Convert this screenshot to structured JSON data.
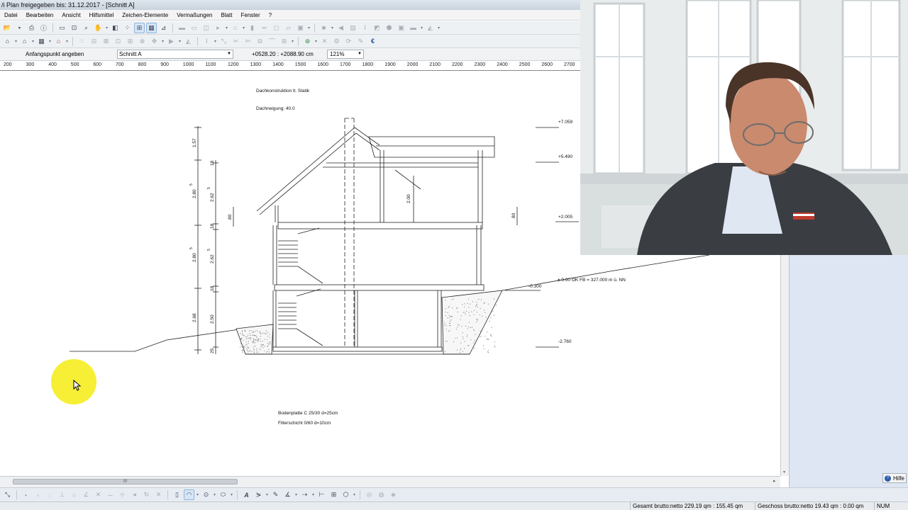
{
  "window": {
    "title": "/i Plan freigegeben bis: 31.12.2017 - [Schnitt A]"
  },
  "menu": [
    "Datei",
    "Bearbeiten",
    "Ansicht",
    "Hilfsmittel",
    "Zeichen-Elemente",
    "Vermaßungen",
    "Blatt",
    "Fenster",
    "?"
  ],
  "infobar": {
    "prompt": "Anfangspunkt angeben",
    "view_select": "Schnitt A",
    "coordinates": "+0528.20 : +2088.90 cm",
    "zoom": "121%"
  },
  "toolbar": {
    "euro_label": "€"
  },
  "ruler": {
    "ticks": [
      "200",
      "300",
      "400",
      "500",
      "600",
      "700",
      "800",
      "900",
      "1000",
      "1100",
      "1200",
      "1300",
      "1400",
      "1500",
      "1600",
      "1700",
      "1800",
      "1900",
      "2000",
      "2100",
      "2200",
      "2300",
      "2400",
      "2500",
      "2600",
      "2700"
    ]
  },
  "drawing": {
    "title": "Dachkonstruktion lt. Statik",
    "roof_pitch": "Dachneigung: 40.0",
    "elevations": [
      "+7.059",
      "+5.490",
      "+2.005",
      "± 0.00 OK FB = 327.000 m ü. NN",
      "-0.300",
      "-2.760"
    ],
    "dim_left": [
      "1.57",
      "2.80",
      "2.80",
      "2.68"
    ],
    "dim_inner": [
      "18",
      "2.62",
      "18",
      "2.62",
      "18",
      "2.50",
      "25"
    ],
    "dim_misc": [
      "80",
      "80",
      "2.00"
    ],
    "superscripts": [
      "5",
      "5",
      "5",
      "5"
    ],
    "note_slab": "Bodenplatte C 25/30 d=25cm",
    "note_layer": "Filterschicht 0/60 d=10cm"
  },
  "scrollbar": {
    "grip": "III"
  },
  "help": {
    "label": "Hilfe"
  },
  "status": {
    "gesamt": "Gesamt brutto:netto 229.19 qm : 155.45 qm",
    "geschoss": "Geschoss brutto:netto 19.43 qm : 0.00 qm",
    "mode": "NUM"
  },
  "colors": {
    "highlight": "#f6ee2a",
    "suit": "#3a3d42",
    "window_light": "#ffffff"
  }
}
